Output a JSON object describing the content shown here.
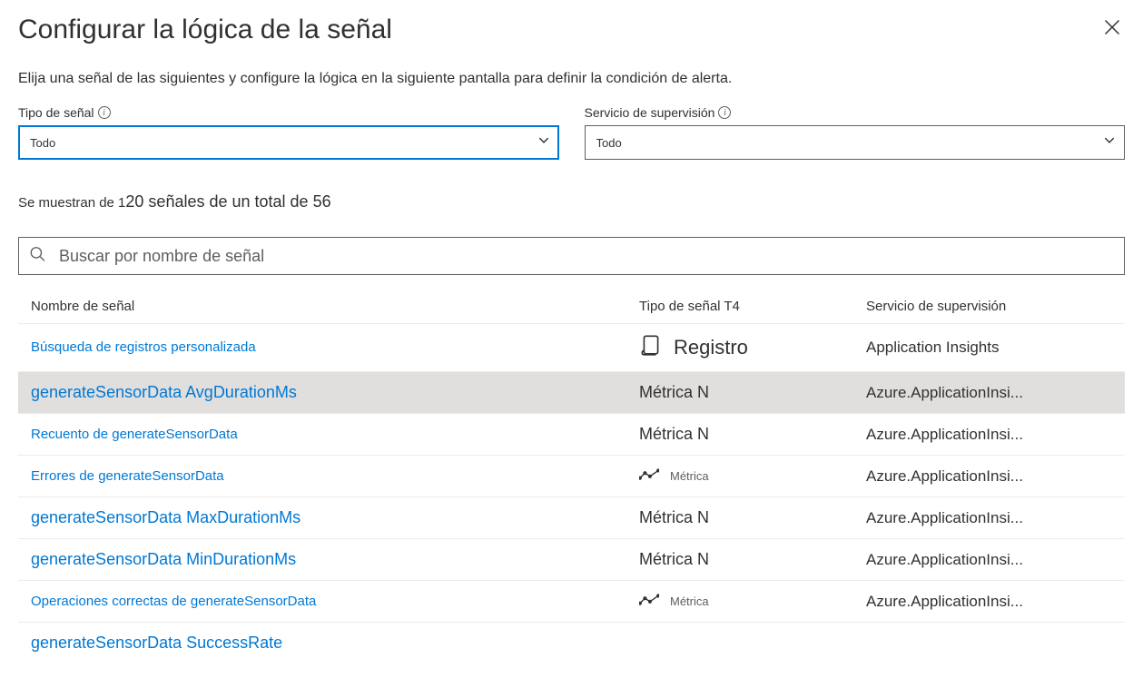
{
  "header": {
    "title": "Configurar la lógica de la señal"
  },
  "subtitle": "Elija una señal de las siguientes y configure la lógica en la siguiente pantalla para definir la condición de alerta.",
  "filters": {
    "signal_type": {
      "label": "Tipo de señal",
      "value": "Todo"
    },
    "monitor_service": {
      "label": "Servicio de supervisión",
      "value": "Todo"
    }
  },
  "count": {
    "prefix": "Se muestran de 1",
    "main": "20 señales de un total de 56"
  },
  "search": {
    "placeholder": "Buscar por nombre de señal"
  },
  "table": {
    "headers": {
      "name": "Nombre de señal",
      "type": "Tipo de señal T4",
      "service": "Servicio de supervisión"
    },
    "rows": [
      {
        "name": "Búsqueda de registros personalizada",
        "type": "Registro",
        "type_style": "log-large",
        "service": "Application Insights",
        "bold": false,
        "highlight": false
      },
      {
        "name": "generateSensorData AvgDurationMs",
        "type": "Métrica N",
        "type_style": "metric-n",
        "service": "Azure.ApplicationInsi...",
        "bold": true,
        "highlight": true
      },
      {
        "name": "Recuento de generateSensorData",
        "type": "Métrica N",
        "type_style": "metric-n",
        "service": "Azure.ApplicationInsi...",
        "bold": false,
        "highlight": false
      },
      {
        "name": "Errores de generateSensorData",
        "type": "Métrica",
        "type_style": "metric-icon",
        "service": "Azure.ApplicationInsi...",
        "bold": false,
        "highlight": false
      },
      {
        "name": "generateSensorData MaxDurationMs",
        "type": "Métrica N",
        "type_style": "metric-n",
        "service": "Azure.ApplicationInsi...",
        "bold": true,
        "highlight": false
      },
      {
        "name": "generateSensorData MinDurationMs",
        "type": "Métrica N",
        "type_style": "metric-n",
        "service": "Azure.ApplicationInsi...",
        "bold": true,
        "highlight": false
      },
      {
        "name": "Operaciones correctas de generateSensorData",
        "type": "Métrica",
        "type_style": "metric-icon",
        "service": "Azure.ApplicationInsi...",
        "bold": false,
        "highlight": false
      },
      {
        "name": "generateSensorData SuccessRate",
        "type": "",
        "type_style": "metric-n",
        "service": "",
        "bold": true,
        "highlight": false
      }
    ]
  }
}
